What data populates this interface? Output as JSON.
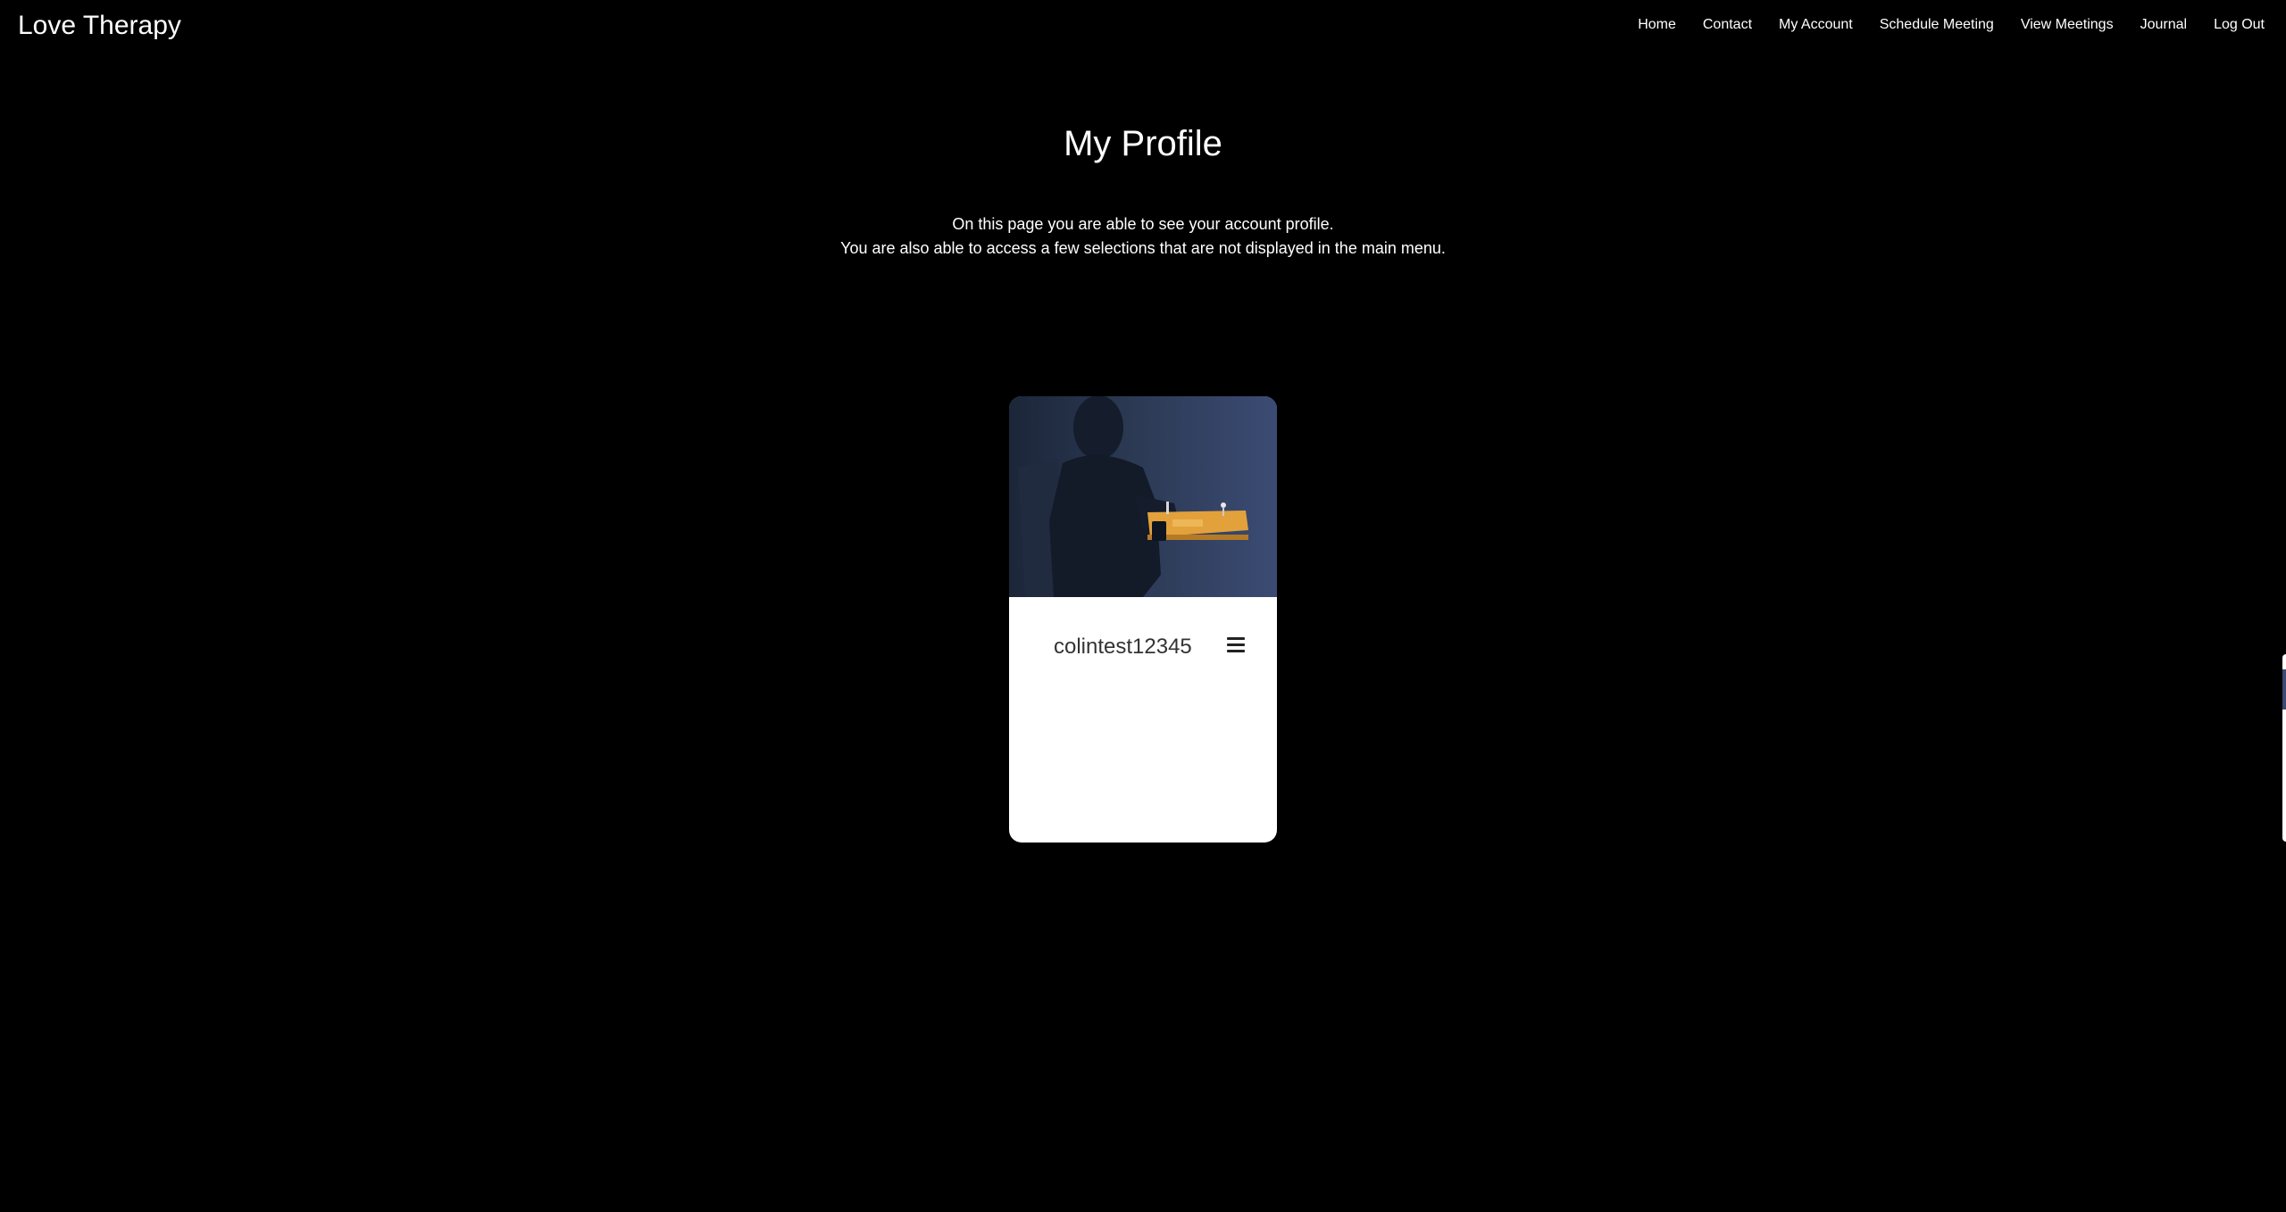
{
  "header": {
    "brand": "Love Therapy",
    "nav": [
      {
        "label": "Home"
      },
      {
        "label": "Contact"
      },
      {
        "label": "My Account"
      },
      {
        "label": "Schedule Meeting"
      },
      {
        "label": "View Meetings"
      },
      {
        "label": "Journal"
      },
      {
        "label": "Log Out"
      }
    ]
  },
  "main": {
    "title": "My Profile",
    "intro_line1": "On this page you are able to see your account profile.",
    "intro_line2": "You are also able to access a few selections that are not displayed in the main menu."
  },
  "profile_card": {
    "username": "colintest12345",
    "menu_icon": "hamburger-menu-icon",
    "image_subject": "person-at-desk-illustration"
  },
  "colors": {
    "page_background": "#000000",
    "text": "#ffffff",
    "card_background": "#ffffff",
    "card_image_blue": "#2c3a55",
    "desk_orange": "#e3a13b"
  }
}
